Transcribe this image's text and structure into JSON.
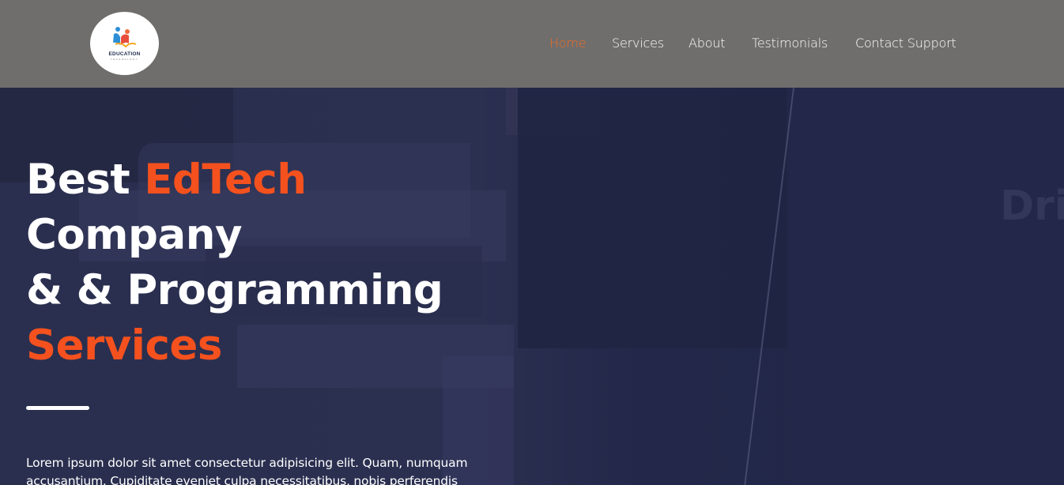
{
  "header": {
    "logo": {
      "text": "EDUCATION",
      "subtext": "TECHNOLOGY",
      "icon": "education-logo-icon"
    },
    "nav": [
      {
        "label": "Home",
        "active": true
      },
      {
        "label": "Services",
        "active": false
      },
      {
        "label": "About",
        "active": false
      },
      {
        "label": "Testimonials",
        "active": false
      },
      {
        "label": "Contact Support",
        "active": false
      }
    ]
  },
  "hero": {
    "headline": {
      "line1_white": "Best",
      "line1_orange": "EdTech",
      "line2": "Company",
      "line3": "& & Programming",
      "line4_orange": "Services"
    },
    "watermark": "Dri",
    "paragraph": "Lorem ipsum dolor sit amet consectetur adipisicing elit. Quam, numquam accusantium. Cupiditate eveniet culpa necessitatibus, nobis perferendis dolores repellendus, natus consectetur recusandae dicta odit."
  },
  "colors": {
    "header_bg": "#6f6e6d",
    "hero_bg": "#262a48",
    "accent": "#f4511e",
    "nav_active": "#f36a21",
    "text": "#ffffff"
  }
}
